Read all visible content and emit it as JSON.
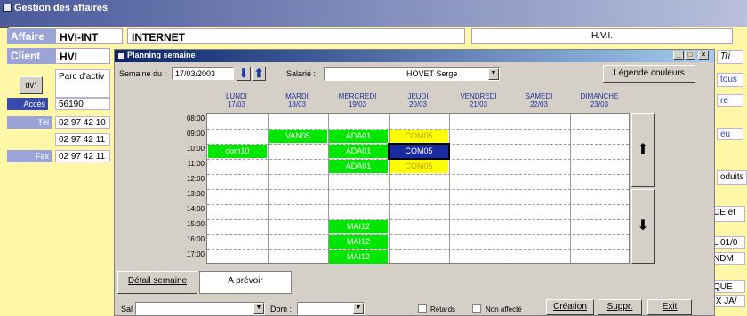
{
  "bg": {
    "title": "Gestion des affaires",
    "affaire_label": "Affaire",
    "affaire_code": "HVI-INT",
    "affaire_name": "INTERNET",
    "affaire_ref": "H.V.I.",
    "client_label": "Client",
    "client_code": "HVI",
    "client_addr": "Parc d'activ",
    "addr_btn": "dv°",
    "acces_label": "Accès",
    "acces_value": "56190",
    "tel_label": "Tél",
    "tel_value": "02 97 42 10",
    "tel2_value": "02 97 42 11",
    "fax_label": "Fax",
    "fax_value": "02 97 42 11",
    "right_items": [
      "Tri",
      "tous",
      "re",
      "eu",
      "oduits",
      "CE et",
      "L 01/0",
      "NDM",
      "QUE",
      "IX JA/"
    ]
  },
  "dialog": {
    "title": "Planning semaine",
    "semaine_label": "Semaine du :",
    "semaine_value": "17/03/2003",
    "salarie_label": "Salarié :",
    "salarie_value": "HOVET Serge",
    "legend_btn": "Légende couleurs",
    "days": [
      {
        "name": "LUNDI",
        "date": "17/03"
      },
      {
        "name": "MARDI",
        "date": "18/03"
      },
      {
        "name": "MERCREDI",
        "date": "19/03"
      },
      {
        "name": "JEUDI",
        "date": "20/03"
      },
      {
        "name": "VENDREDI",
        "date": "21/03"
      },
      {
        "name": "SAMEDI",
        "date": "22/03"
      },
      {
        "name": "DIMANCHE",
        "date": "23/03"
      }
    ],
    "times": [
      "08:00",
      "09:00",
      "10:00",
      "11:00",
      "12:00",
      "13:00",
      "14:00",
      "15:00",
      "16:00",
      "17:00"
    ],
    "events": [
      {
        "day": 0,
        "slot": 2,
        "label": "com10",
        "color": "green"
      },
      {
        "day": 1,
        "slot": 1,
        "label": "VAN05",
        "color": "green"
      },
      {
        "day": 2,
        "slot": 1,
        "label": "ADA01",
        "color": "green"
      },
      {
        "day": 2,
        "slot": 2,
        "label": "ADA01",
        "color": "green"
      },
      {
        "day": 2,
        "slot": 3,
        "label": "ADA01",
        "color": "green"
      },
      {
        "day": 3,
        "slot": 1,
        "label": "COM05",
        "color": "yellow"
      },
      {
        "day": 3,
        "slot": 2,
        "label": "COM05",
        "color": "selected"
      },
      {
        "day": 3,
        "slot": 3,
        "label": "COM05",
        "color": "yellow"
      },
      {
        "day": 2,
        "slot": 7,
        "label": "MAI12",
        "color": "green"
      },
      {
        "day": 2,
        "slot": 8,
        "label": "MAI12",
        "color": "green"
      },
      {
        "day": 2,
        "slot": 9,
        "label": "MAI12",
        "color": "green"
      }
    ],
    "tab_detail": "Détail semaine",
    "tab_aprevoir": "A prévoir",
    "sal_label": "Sal :",
    "dom_label": "Dom :",
    "retards_label": "Retards",
    "non_affecte_label": "Non affecté",
    "creation_btn": "Création",
    "suppr_btn": "Suppr.",
    "exit_btn": "Exit"
  },
  "colors": {
    "green": "#00e600",
    "yellow": "#ffff00",
    "selected": "#1a2aa0"
  }
}
